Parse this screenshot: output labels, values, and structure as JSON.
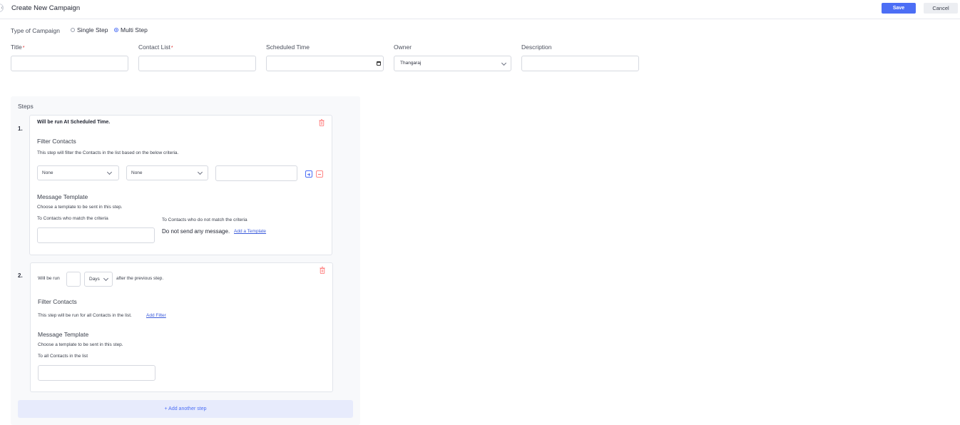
{
  "header": {
    "title": "Create New Campaign",
    "save_label": "Save",
    "cancel_label": "Cancel"
  },
  "campaign_type": {
    "label": "Type of Campaign",
    "options": [
      {
        "label": "Single Step",
        "checked": false
      },
      {
        "label": "Multi Step",
        "checked": true
      }
    ]
  },
  "fields": {
    "title": {
      "label": "Title",
      "required": "*",
      "value": ""
    },
    "contact_list": {
      "label": "Contact List",
      "required": "*",
      "value": ""
    },
    "scheduled_time": {
      "label": "Scheduled Time",
      "value": ""
    },
    "owner": {
      "label": "Owner",
      "value": "Thangaraj"
    },
    "description": {
      "label": "Description",
      "value": ""
    }
  },
  "steps": {
    "title": "Steps",
    "step1": {
      "number": "1.",
      "run_text": "Will be run At Scheduled Time.",
      "filter_heading": "Filter Contacts",
      "filter_desc": "This step will filter the Contacts in the list based on the below criteria.",
      "filter_field": "None",
      "filter_operator": "None",
      "filter_value": "",
      "template_heading": "Message Template",
      "template_desc": "Choose a template to be sent in this step.",
      "match_label": "To Contacts who match the criteria",
      "nomatch_label": "To Contacts who do not match the criteria",
      "nomatch_message": "Do not send any message.",
      "add_template_link": "Add a Template"
    },
    "step2": {
      "number": "2.",
      "run_prefix": "Will be run",
      "delay_value": "",
      "delay_unit": "Days",
      "run_suffix": "after the previous step.",
      "filter_heading": "Filter Contacts",
      "filter_desc": "This step will be run for all Contacts in the list.",
      "add_filter_link": "Add Filter",
      "template_heading": "Message Template",
      "template_desc": "Choose a template to be sent in this step.",
      "all_label": "To all Contacts in the list"
    },
    "add_step_label": "+ Add another step"
  },
  "colors": {
    "primary": "#4c6ef5",
    "danger": "#e03131"
  }
}
